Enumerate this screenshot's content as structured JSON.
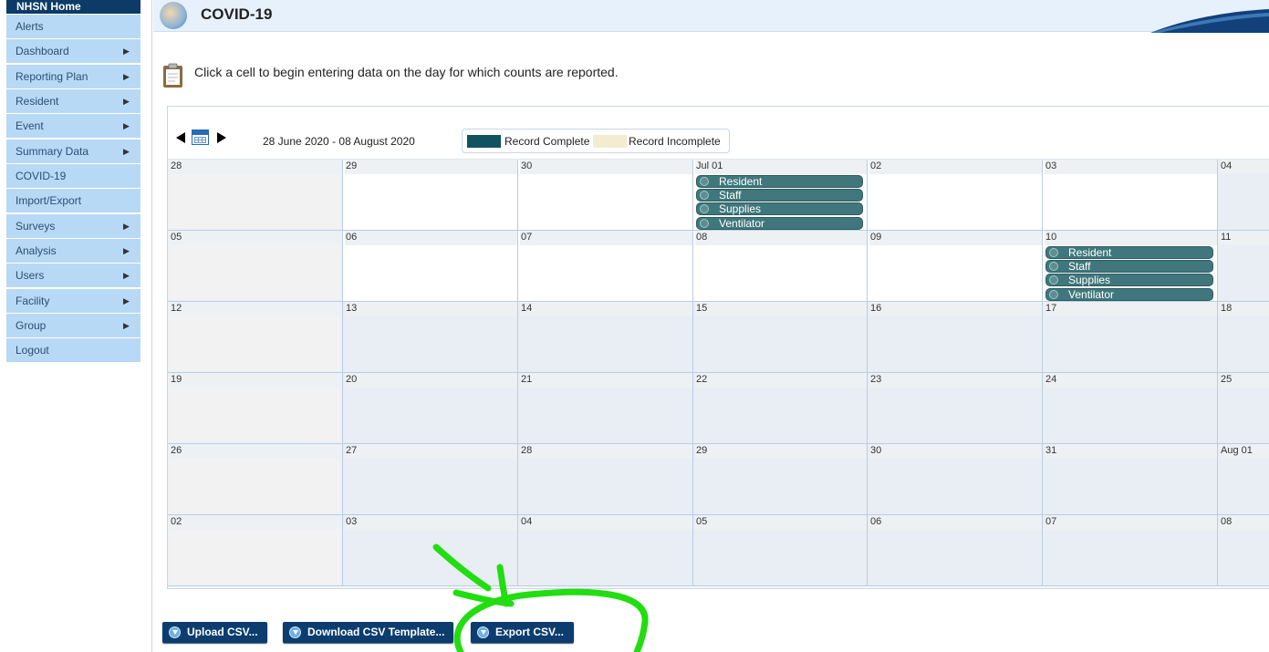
{
  "sidebar": {
    "home_label": "NHSN Home",
    "items": [
      {
        "label": "Alerts",
        "has_submenu": false
      },
      {
        "label": "Dashboard",
        "has_submenu": true
      },
      {
        "label": "Reporting Plan",
        "has_submenu": true
      },
      {
        "label": "Resident",
        "has_submenu": true
      },
      {
        "label": "Event",
        "has_submenu": true
      },
      {
        "label": "Summary Data",
        "has_submenu": true
      },
      {
        "label": "COVID-19",
        "has_submenu": false
      },
      {
        "label": "Import/Export",
        "has_submenu": false
      },
      {
        "label": "Surveys",
        "has_submenu": true
      },
      {
        "label": "Analysis",
        "has_submenu": true
      },
      {
        "label": "Users",
        "has_submenu": true
      },
      {
        "label": "Facility",
        "has_submenu": true
      },
      {
        "label": "Group",
        "has_submenu": true
      },
      {
        "label": "Logout",
        "has_submenu": false
      }
    ]
  },
  "header": {
    "title": "COVID-19"
  },
  "instruction": "Click a cell to begin entering data on the day for which counts are reported.",
  "calendar": {
    "date_range": "28 June 2020  -  08 August 2020",
    "legend": {
      "complete_label": "Record Complete",
      "incomplete_label": "Record Incomplete",
      "complete_color": "#115261",
      "incomplete_color": "#f3ecd0"
    },
    "weeks": [
      [
        "28",
        "29",
        "30",
        "Jul 01",
        "02",
        "03",
        "04"
      ],
      [
        "05",
        "06",
        "07",
        "08",
        "09",
        "10",
        "11"
      ],
      [
        "12",
        "13",
        "14",
        "15",
        "16",
        "17",
        "18"
      ],
      [
        "19",
        "20",
        "21",
        "22",
        "23",
        "24",
        "25"
      ],
      [
        "26",
        "27",
        "28",
        "29",
        "30",
        "31",
        "Aug 01"
      ],
      [
        "02",
        "03",
        "04",
        "05",
        "06",
        "07",
        "08"
      ]
    ],
    "white_cells": [
      "0-1",
      "0-2",
      "0-3",
      "0-4",
      "0-5",
      "1-1",
      "1-2",
      "1-3",
      "1-4",
      "1-5"
    ],
    "events": {
      "0-3": [
        "Resident",
        "Staff",
        "Supplies",
        "Ventilator"
      ],
      "1-5": [
        "Resident",
        "Staff",
        "Supplies",
        "Ventilator"
      ]
    }
  },
  "buttons": {
    "upload_label": "Upload CSV...",
    "template_label": "Download CSV Template...",
    "export_label": "Export CSV..."
  },
  "colors": {
    "nav_bg": "#b7d9f6",
    "home_bg": "#0b3b66",
    "button_bg": "#0c3d6e",
    "event_bg": "#3f777c",
    "annotation": "#22dd11"
  }
}
